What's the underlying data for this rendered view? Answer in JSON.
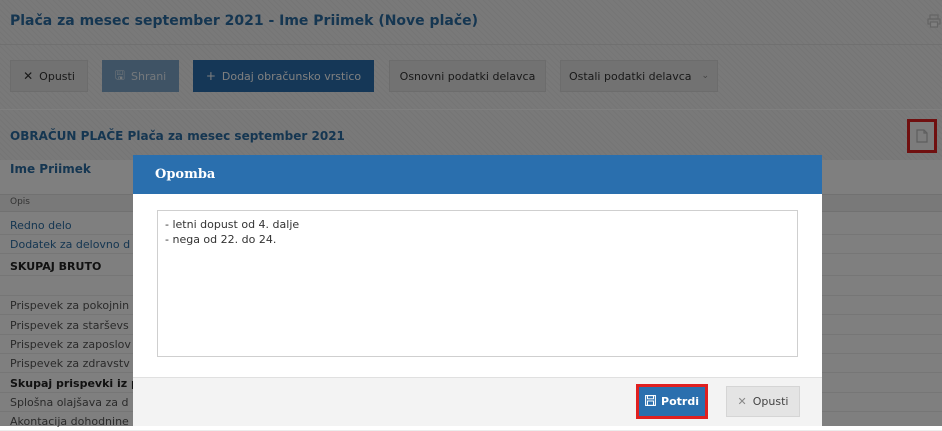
{
  "page": {
    "title": "Plača za mesec september 2021 - Ime Priimek (Nove plače)"
  },
  "toolbar": {
    "cancel_label": "Opusti",
    "save_label": "Shrani",
    "add_row_label": "Dodaj obračunsko vrstico",
    "basic_data_label": "Osnovni podatki delavca",
    "other_data_label": "Ostali podatki delavca"
  },
  "section": {
    "title": "OBRAČUN PLAČE Plača za mesec september 2021",
    "person": "Ime Priimek",
    "column_header": "Opis"
  },
  "rows": [
    {
      "label": "Redno delo"
    },
    {
      "label": "Dodatek za delovno d"
    },
    {
      "label": "SKUPAJ BRUTO"
    },
    {
      "label": ""
    },
    {
      "label": "Prispevek za pokojnin"
    },
    {
      "label": "Prispevek za starševs"
    },
    {
      "label": "Prispevek za zaposlov"
    },
    {
      "label": "Prispevek za zdravstv"
    },
    {
      "label": "Skupaj prispevki iz p"
    },
    {
      "label": "Splošna olajšava za d"
    },
    {
      "label": "Akontacija dohodnine"
    }
  ],
  "modal": {
    "title": "Opomba",
    "note_lines": [
      "- letni dopust od 4. dalje",
      "- nega od 22. do 24."
    ],
    "confirm_label": "Potrdi",
    "cancel_label": "Opusti"
  },
  "icons": {
    "print": "print-icon",
    "note": "note-icon",
    "close": "close-x-icon",
    "save": "floppy-icon",
    "plus": "plus-icon",
    "caret": "chevron-down-icon"
  },
  "colors": {
    "brand_blue": "#2a6fae",
    "link_blue": "#2b6ca3",
    "highlight_red": "#e02020"
  }
}
